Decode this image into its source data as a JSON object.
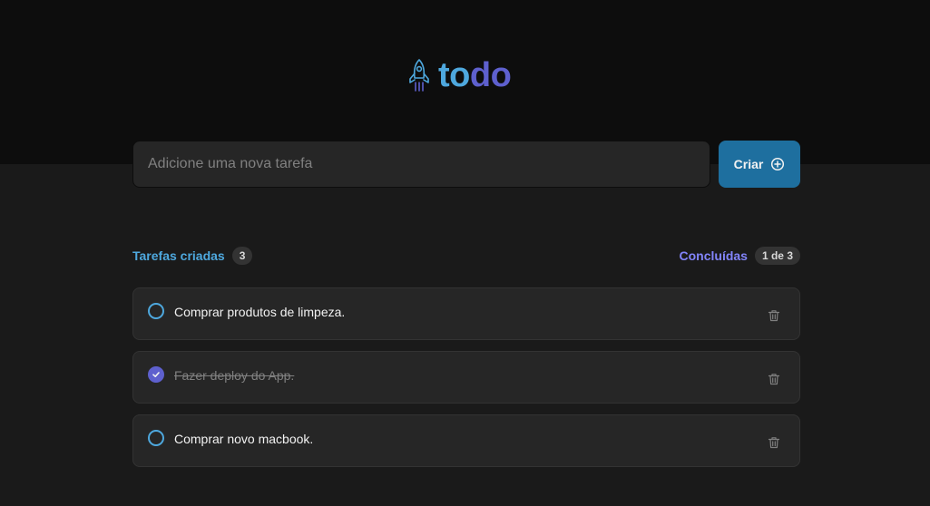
{
  "brand": {
    "part1": "to",
    "part2": "do"
  },
  "new_task": {
    "placeholder": "Adicione uma nova tarefa",
    "value": ""
  },
  "create_button": {
    "label": "Criar"
  },
  "counters": {
    "created_label": "Tarefas criadas",
    "created_count": "3",
    "done_label": "Concluídas",
    "done_count": "1 de 3"
  },
  "tasks": [
    {
      "text": "Comprar produtos de limpeza.",
      "done": false
    },
    {
      "text": "Fazer deploy do App.",
      "done": true
    },
    {
      "text": "Comprar novo macbook.",
      "done": false
    }
  ],
  "colors": {
    "blue": "#4ea8de",
    "purple": "#5e60ce",
    "purple_light": "#8284fa",
    "button": "#1e6f9f"
  },
  "icons": {
    "logo": "rocket-icon",
    "create": "plus-circle-icon",
    "checked": "check-icon",
    "delete": "trash-icon"
  }
}
